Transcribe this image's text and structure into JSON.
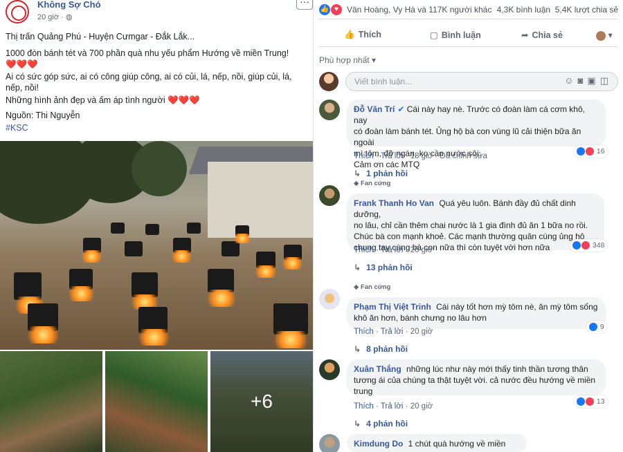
{
  "post": {
    "page_name": "Không Sợ Chó",
    "time": "20 giờ",
    "globe_icon": "globe-icon",
    "lines": [
      "Thị trấn Quảng Phú - Huyện Cưmgar - Đắk Lắk...",
      "1000 đòn bánh tét và 700 phần quà nhu yếu phẩm Hướng về miền Trung!",
      "❤️❤️❤️",
      "Ai có sức góp sức, ai có công giúp công, ai có củi, lá, nếp, nồi, giúp củi, lá,",
      "nếp, nồi!",
      "Những hình ảnh đẹp và ấm áp tình người ❤️❤️❤️",
      "Nguồn: Thi Nguyễn",
      "#KSC"
    ],
    "more_photos": "+6"
  },
  "reactions": {
    "names": "Vân Hoàng, Vy Hà và 117K người khác",
    "comments_count": "4,3K bình luận",
    "shares_count": "5,4K lượt chia sẻ"
  },
  "actions": {
    "like": "Thích",
    "comment": "Bình luận",
    "share": "Chia sẻ"
  },
  "sort": {
    "label": "Phù hợp nhất"
  },
  "comment_box": {
    "placeholder": "Viết bình luận..."
  },
  "comments": [
    {
      "name": "Đỗ Văn Trí",
      "verified": true,
      "lines": [
        "Cái này hay nè. Trước có đoàn làm cá cơm khô, nay",
        "có đoàn làm bánh tét. Ủng hộ bà con vùng lũ cải thiện bữa ăn ngoài",
        "mì tôm, đỡ ngán, ko cần nước sôi.",
        "Cảm ơn các MTQ"
      ],
      "like": "Thích",
      "reply": "Trả lời",
      "time": "18 giờ",
      "edited": "Đã chỉnh sửa",
      "reaction_count": "16",
      "replies": "1 phản hồi"
    },
    {
      "badge": "Fan cứng",
      "name": "Frank Thanh Ho Van",
      "lines": [
        "Quá yêu luôn. Bánh đầy đủ chất dinh dưỡng,",
        "no lâu, chỉ cần thêm chai nước là 1 gia đình đủ ăn 1 bữa no rồi.",
        "Chúc bà con mạnh khoẻ. Các mạnh thường quân cùng ủng hộ",
        "chung tay cùng bà con nữa thì còn tuyệt vời hơn nữa"
      ],
      "like": "Thích",
      "reply": "Trả lời",
      "time": "20 giờ",
      "reaction_count": "348",
      "replies": "13 phản hồi"
    },
    {
      "badge": "Fan cứng",
      "name": "Phạm Thị Việt Trinh",
      "lines": [
        "Cái này tốt hơn mỳ tôm nè, ăn mỳ tôm sống",
        "khô ăn hơn, bánh chưng no lâu hơn"
      ],
      "like": "Thích",
      "reply": "Trả lời",
      "time": "20 giờ",
      "reaction_count": "9",
      "replies": "8 phản hồi"
    },
    {
      "name": "Xuân Thắng",
      "lines": [
        "những lúc như này mới thấy tinh thần tương thân",
        "tương ái của chúng ta thật tuyệt vời. cả nước đều hướng về miền",
        "trung"
      ],
      "like": "Thích",
      "reply": "Trả lời",
      "time": "20 giờ",
      "reaction_count": "13",
      "replies": "4 phản hồi"
    },
    {
      "name": "Kimdung Do",
      "lines": [
        "1 chút quà hướng về miền trung"
      ]
    }
  ],
  "colors": {
    "link": "#385898",
    "like_blue": "#1877f2",
    "heart_red": "#f33e58",
    "bubble_bg": "#f2f3f5"
  }
}
